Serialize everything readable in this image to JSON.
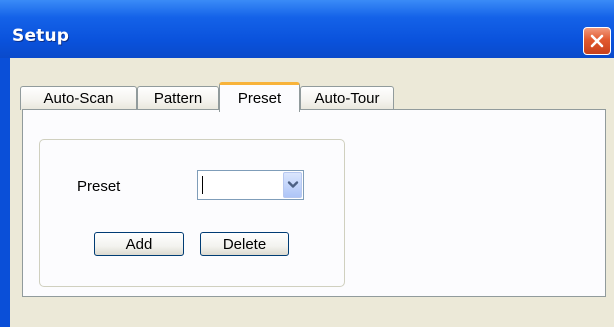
{
  "window": {
    "title": "Setup"
  },
  "tabs": [
    {
      "label": "Auto-Scan",
      "active": false
    },
    {
      "label": "Pattern",
      "active": false
    },
    {
      "label": "Preset",
      "active": true
    },
    {
      "label": "Auto-Tour",
      "active": false
    }
  ],
  "preset_group": {
    "label": "Preset",
    "combo": {
      "value": "",
      "icon": "chevron-down-icon"
    },
    "add_label": "Add",
    "delete_label": "Delete"
  },
  "colors": {
    "titlebar": "#0a52dc",
    "close_button": "#e25a2f",
    "active_tab_accent": "#f8b33a",
    "dialog_face": "#ece9d8",
    "panel": "#fcfcfe"
  }
}
